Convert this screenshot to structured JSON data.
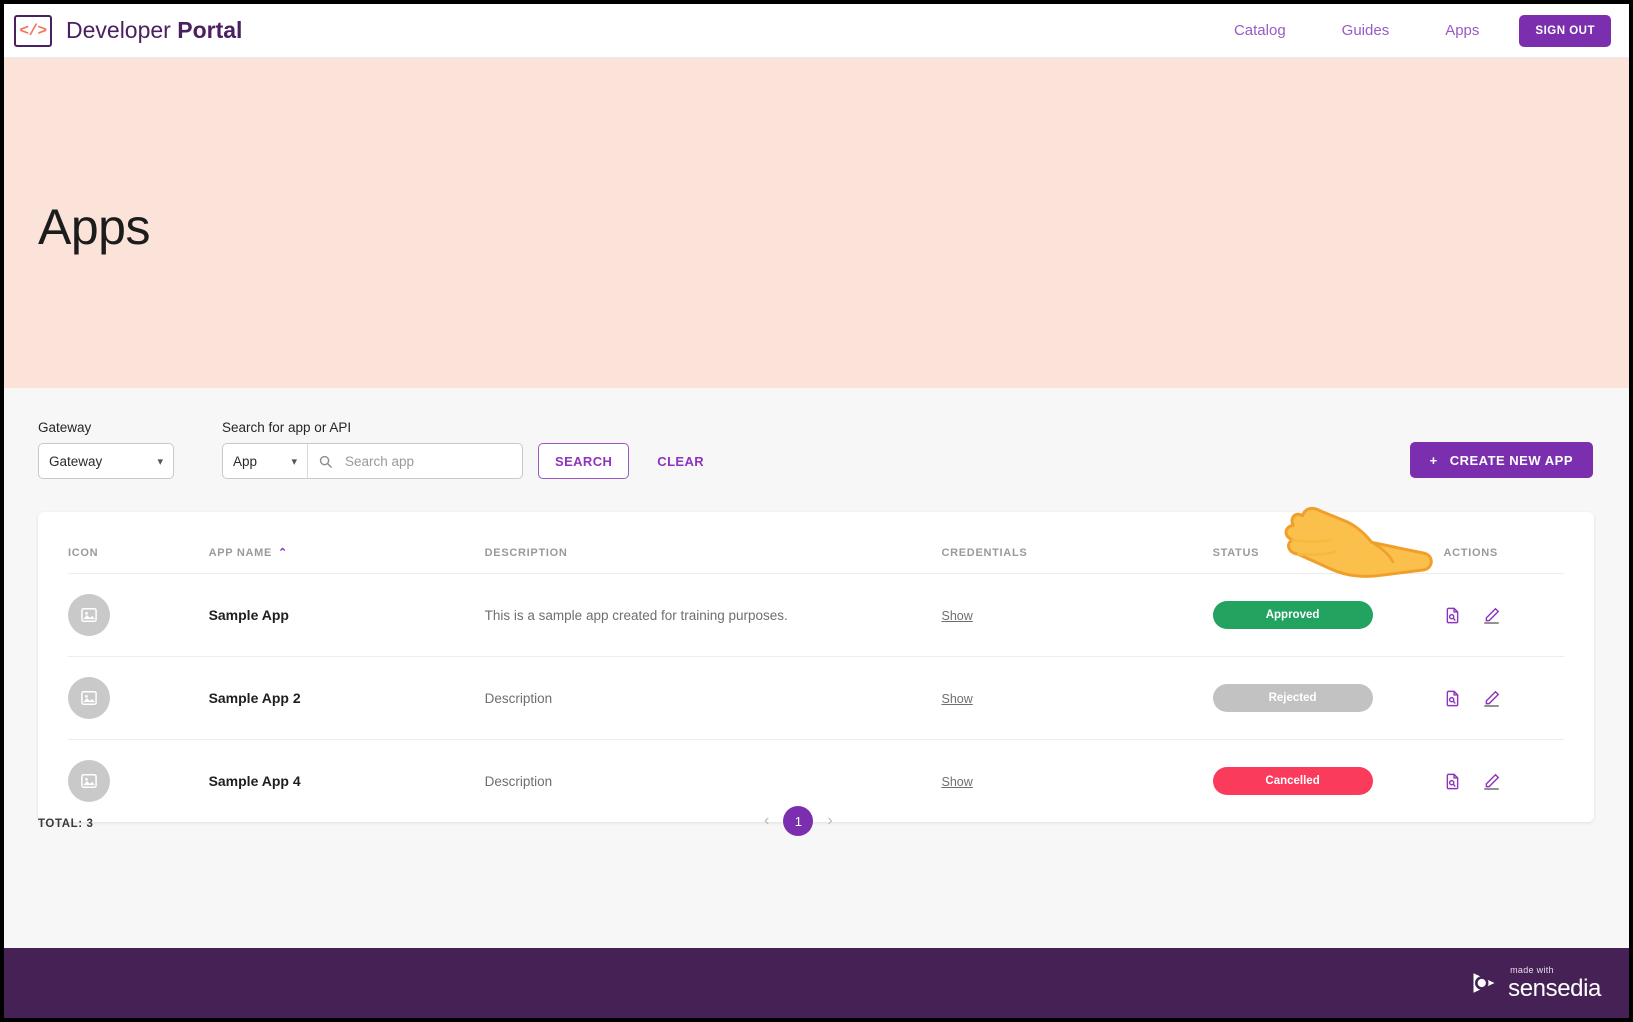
{
  "header": {
    "logo_icon": "code-brackets-icon",
    "logo_glyph": "</>",
    "brand_first": "Developer ",
    "brand_second": "Portal",
    "nav": [
      {
        "label": "Catalog",
        "name": "nav-catalog"
      },
      {
        "label": "Guides",
        "name": "nav-guides"
      },
      {
        "label": "Apps",
        "name": "nav-apps"
      }
    ],
    "sign_out_label": "SIGN OUT"
  },
  "hero": {
    "title": "Apps",
    "background_color": "#fce3da"
  },
  "filters": {
    "gateway_label": "Gateway",
    "gateway_value": "Gateway",
    "search_label": "Search for app or API",
    "search_type_value": "App",
    "search_placeholder": "Search app",
    "search_value": "",
    "search_button": "SEARCH",
    "clear_button": "CLEAR",
    "create_button": "CREATE NEW APP",
    "create_button_plus": "+",
    "search_icon": "magnifier-icon",
    "caret_icon": "chevron-down-icon"
  },
  "table": {
    "columns": [
      {
        "label": "ICON",
        "name": "col-icon"
      },
      {
        "label": "APP NAME",
        "name": "col-app-name",
        "sort": "⌃"
      },
      {
        "label": "DESCRIPTION",
        "name": "col-description"
      },
      {
        "label": "CREDENTIALS",
        "name": "col-credentials"
      },
      {
        "label": "STATUS",
        "name": "col-status"
      },
      {
        "label": "ACTIONS",
        "name": "col-actions"
      }
    ],
    "rows": [
      {
        "icon": "image-placeholder-icon",
        "name": "Sample App",
        "description": "This is a sample app created for training purposes.",
        "credentials_link": "Show",
        "status": "Approved",
        "status_color": "#22a35f"
      },
      {
        "icon": "image-placeholder-icon",
        "name": "Sample App 2",
        "description": "Description",
        "credentials_link": "Show",
        "status": "Rejected",
        "status_color": "#c2c2c2"
      },
      {
        "icon": "image-placeholder-icon",
        "name": "Sample App 4",
        "description": "Description",
        "credentials_link": "Show",
        "status": "Cancelled",
        "status_color": "#fa3b5c"
      }
    ],
    "action_icons": [
      "document-search-icon",
      "pencil-edit-icon"
    ]
  },
  "footer_bar": {
    "total_label": "TOTAL: 3",
    "prev_arrow": "‹",
    "page_current": "1",
    "next_arrow": "›"
  },
  "footer": {
    "made_with": "made with",
    "brand": "sensedia",
    "logo_icon": "sensedia-swirl-icon"
  },
  "colors": {
    "accent_purple": "#7b2fae",
    "link_purple": "#9b59c4",
    "brand_dark": "#4b2060",
    "footer_bg": "#452155",
    "hero_bg": "#fce3da"
  },
  "cursor": {
    "icon": "pointing-hand-cursor"
  }
}
